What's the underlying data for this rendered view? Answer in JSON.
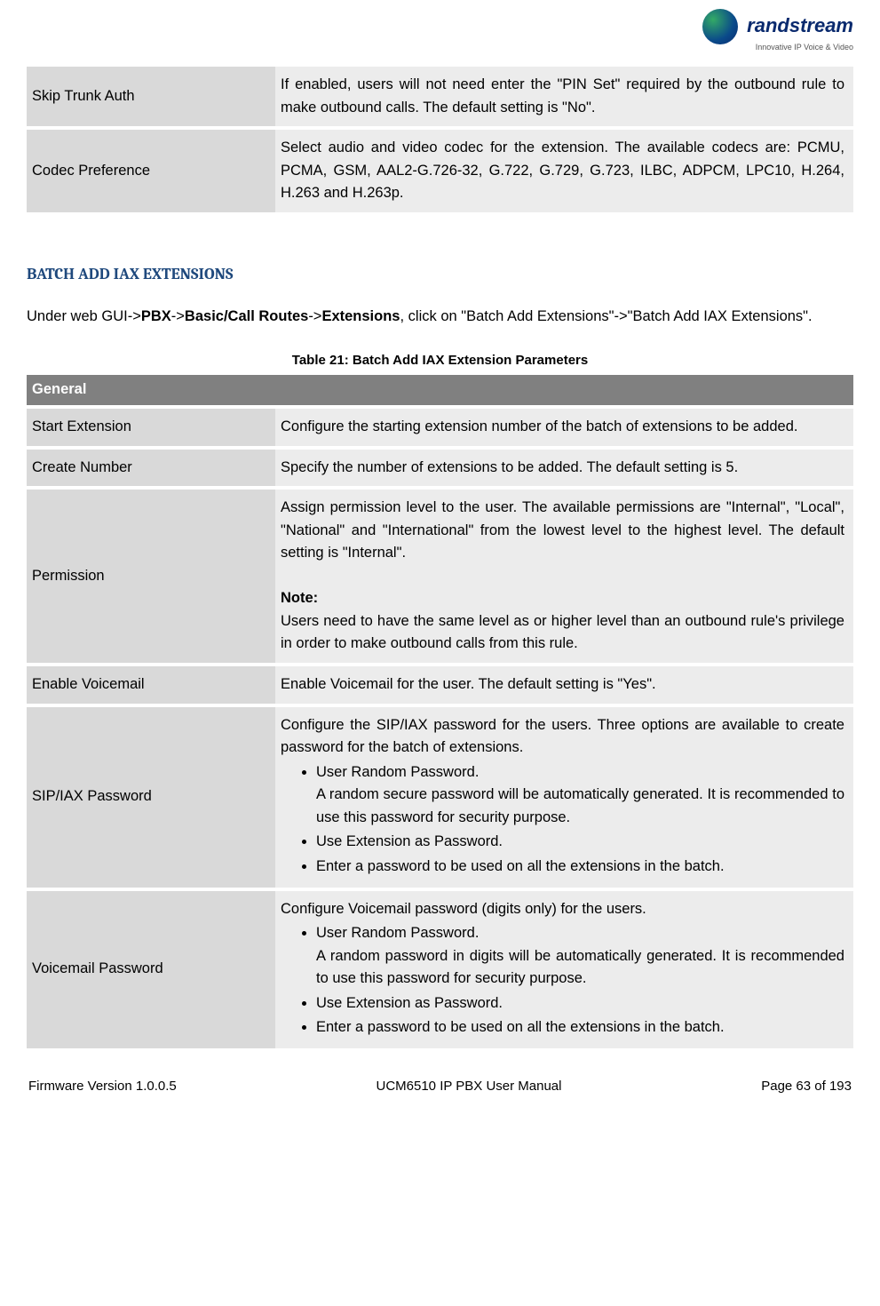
{
  "logo": {
    "brand": "randstream",
    "tag": "Innovative IP Voice & Video"
  },
  "top_rows": [
    {
      "label": "Skip Trunk Auth",
      "desc": "If enabled, users will not need enter the \"PIN Set\" required by the outbound rule to make outbound calls. The default setting is \"No\"."
    },
    {
      "label": "Codec Preference",
      "desc": "Select audio and video codec for the extension. The available codecs are: PCMU, PCMA, GSM, AAL2-G.726-32, G.722, G.729, G.723, ILBC, ADPCM, LPC10, H.264, H.263 and H.263p."
    }
  ],
  "section_heading": "BATCH ADD IAX EXTENSIONS",
  "body_para_prefix": "Under web GUI->",
  "body_bold1": "PBX",
  "body_sep1": "->",
  "body_bold2": "Basic/Call Routes",
  "body_sep2": "->",
  "body_bold3": "Extensions",
  "body_suffix": ", click on \"Batch Add Extensions\"->\"Batch Add IAX Extensions\".",
  "table_caption": "Table 21: Batch Add IAX Extension Parameters",
  "section_header_row": "General",
  "rows": {
    "start_ext": {
      "label": "Start Extension",
      "desc": "Configure the starting extension number of the batch of extensions to be added."
    },
    "create_num": {
      "label": "Create Number",
      "desc": "Specify the number of extensions to be added. The default setting is 5."
    },
    "permission": {
      "label": "Permission",
      "para1": "Assign permission level to the user. The available permissions are \"Internal\", \"Local\", \"National\" and \"International\" from the lowest level to the highest level. The default setting is \"Internal\".",
      "note_label": "Note:",
      "para2": "Users need to have the same level as or higher level than an outbound rule's privilege in order to make outbound calls from this rule."
    },
    "enable_vm": {
      "label": "Enable Voicemail",
      "desc": "Enable Voicemail for the user. The default setting is \"Yes\"."
    },
    "sipiax_pw": {
      "label": "SIP/IAX Password",
      "intro": "Configure the SIP/IAX password for the users. Three options are available to create password for the batch of extensions.",
      "b1": "User Random Password.",
      "b1_sub": "A random secure password will be automatically generated. It is recommended to use this password for security purpose.",
      "b2": "Use Extension as Password.",
      "b3": "Enter a password to be used on all the extensions in the batch."
    },
    "vm_pw": {
      "label": "Voicemail Password",
      "intro": "Configure Voicemail password (digits only) for the users.",
      "b1": "User Random Password.",
      "b1_sub": "A random password in digits will be automatically generated. It is recommended to use this password for security purpose.",
      "b2": "Use Extension as Password.",
      "b3": "Enter a password to be used on all the extensions in the batch."
    }
  },
  "footer": {
    "left": "Firmware Version 1.0.0.5",
    "center": "UCM6510 IP PBX User Manual",
    "right": "Page 63 of 193"
  }
}
